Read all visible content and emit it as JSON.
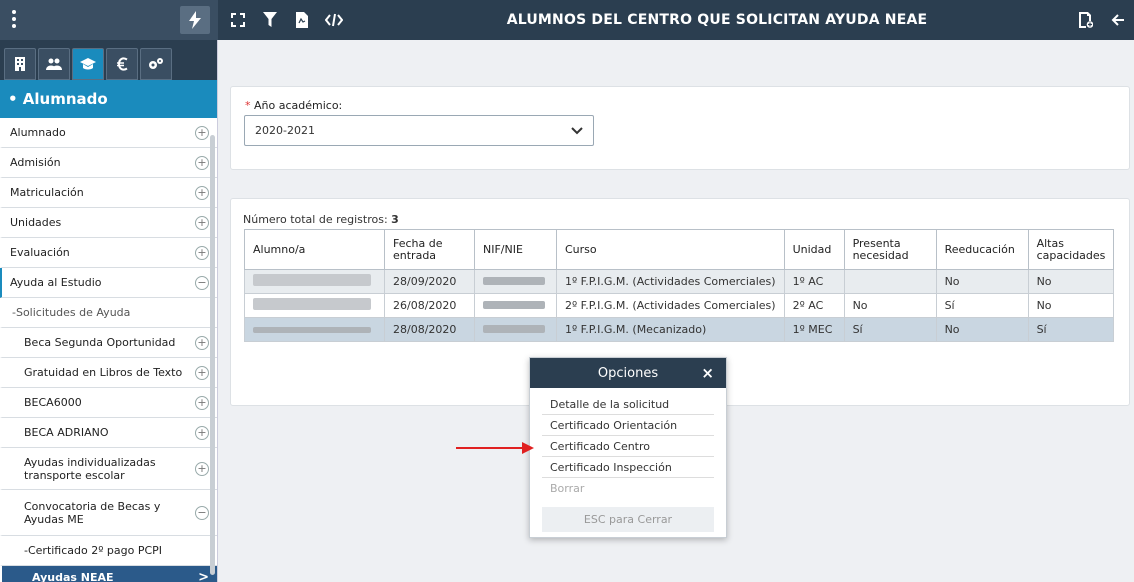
{
  "header": {
    "title": "ALUMNOS DEL CENTRO QUE SOLICITAN AYUDA NEAE"
  },
  "sidebar": {
    "section": "• Alumnado",
    "items": [
      {
        "label": "Alumnado",
        "state": "+"
      },
      {
        "label": "Admisión",
        "state": "+"
      },
      {
        "label": "Matriculación",
        "state": "+"
      },
      {
        "label": "Unidades",
        "state": "+"
      },
      {
        "label": "Evaluación",
        "state": "+"
      },
      {
        "label": "Ayuda al Estudio",
        "state": "−"
      },
      {
        "label": "-Solicitudes de Ayuda",
        "state": ""
      },
      {
        "label": "Beca Segunda Oportunidad",
        "state": "+"
      },
      {
        "label": "Gratuidad en Libros de Texto",
        "state": "+"
      },
      {
        "label": "BECA6000",
        "state": "+"
      },
      {
        "label": "BECA ADRIANO",
        "state": "+"
      },
      {
        "label": "Ayudas individualizadas transporte escolar",
        "state": "+"
      },
      {
        "label": "Convocatoria de Becas y Ayudas ME",
        "state": "−"
      },
      {
        "label": "-Certificado 2º pago PCPI",
        "state": ""
      },
      {
        "label": "Ayudas NEAE",
        "state": ">"
      }
    ]
  },
  "filter": {
    "label": "Año académico:",
    "required_mark": "*",
    "value": "2020-2021"
  },
  "table": {
    "count_label": "Número total de registros:",
    "count": "3",
    "columns": [
      "Alumno/a",
      "Fecha de entrada",
      "NIF/NIE",
      "Curso",
      "Unidad",
      "Presenta necesidad",
      "Reeducación",
      "Altas capacidades"
    ],
    "rows": [
      {
        "fecha": "28/09/2020",
        "curso": "1º F.P.I.G.M. (Actividades Comerciales)",
        "unidad": "1º AC",
        "necesidad": "",
        "reeducacion": "No",
        "altas": "No"
      },
      {
        "fecha": "26/08/2020",
        "curso": "2º F.P.I.G.M. (Actividades Comerciales)",
        "unidad": "2º AC",
        "necesidad": "No",
        "reeducacion": "Sí",
        "altas": "No"
      },
      {
        "fecha": "28/08/2020",
        "curso": "1º F.P.I.G.M. (Mecanizado)",
        "unidad": "1º MEC",
        "necesidad": "Sí",
        "reeducacion": "No",
        "altas": "Sí"
      }
    ]
  },
  "popup": {
    "title": "Opciones",
    "close": "×",
    "items": [
      "Detalle de la solicitud",
      "Certificado Orientación",
      "Certificado Centro",
      "Certificado Inspección",
      "Borrar"
    ],
    "esc": "ESC para Cerrar"
  },
  "colors": {
    "topbar": "#2b3e50",
    "accent": "#1a8bbd",
    "arrow": "#e02020"
  }
}
